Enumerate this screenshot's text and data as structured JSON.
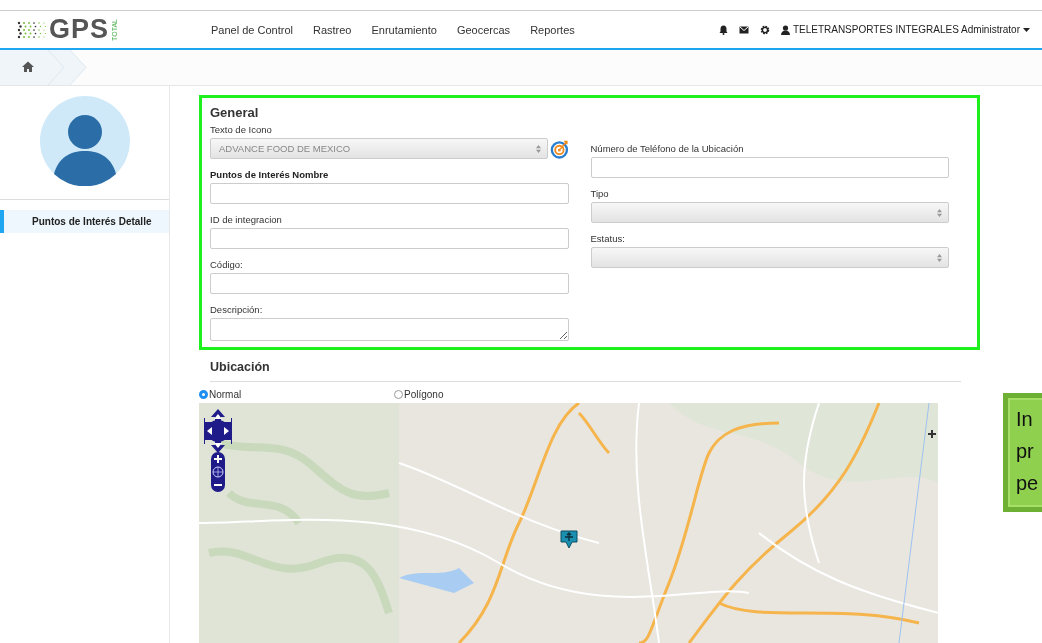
{
  "header": {
    "logo_text": "GPS",
    "logo_subtext": "TOTAL",
    "nav": [
      {
        "label": "Panel de Control"
      },
      {
        "label": "Rastreo"
      },
      {
        "label": "Enrutamiento"
      },
      {
        "label": "Geocercas"
      },
      {
        "label": "Reportes"
      }
    ],
    "user": "TELETRANSPORTES INTEGRALES Administrator"
  },
  "sidebar": {
    "items": [
      {
        "label": "Puntos de Interés Detalle",
        "selected": true
      }
    ]
  },
  "general": {
    "title": "General",
    "left_fields": [
      {
        "kind": "icon-select",
        "label": "Texto de Icono",
        "value": "ADVANCE FOOD DE MEXICO",
        "required": false
      },
      {
        "kind": "text",
        "label": "Puntos de Interés Nombre",
        "required": true
      },
      {
        "kind": "text",
        "label": "ID de integracion",
        "required": false
      },
      {
        "kind": "text",
        "label": "Código:",
        "required": false
      },
      {
        "kind": "textarea",
        "label": "Descripción:",
        "required": false
      }
    ],
    "right_fields": [
      {
        "kind": "text",
        "label": "Número de Teléfono de la Ubicación",
        "required": false
      },
      {
        "kind": "select",
        "label": "Tipo",
        "required": false
      },
      {
        "kind": "select",
        "label": "Estatus:",
        "required": false
      }
    ]
  },
  "location": {
    "title": "Ubicación",
    "modes": [
      {
        "label": "Normal",
        "selected": true
      },
      {
        "label": "Polígono",
        "selected": false
      }
    ]
  },
  "callout": {
    "lines": [
      "In",
      "pr",
      "pe"
    ]
  }
}
